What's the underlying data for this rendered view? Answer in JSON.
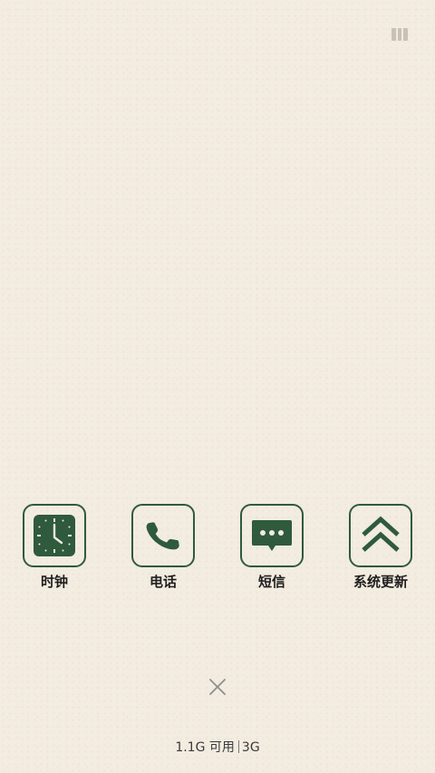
{
  "status_icon": "recent-apps-icon",
  "apps": [
    {
      "label": "时钟",
      "icon": "clock-icon"
    },
    {
      "label": "电话",
      "icon": "phone-icon"
    },
    {
      "label": "短信",
      "icon": "message-icon"
    },
    {
      "label": "系统更新",
      "icon": "system-update-icon"
    }
  ],
  "close_icon": "close-icon",
  "memory": {
    "available": "1.1G 可用",
    "total": "3G"
  },
  "colors": {
    "background": "#f3ece0",
    "accent": "#2f5a3c",
    "text": "#1e1e1e"
  }
}
